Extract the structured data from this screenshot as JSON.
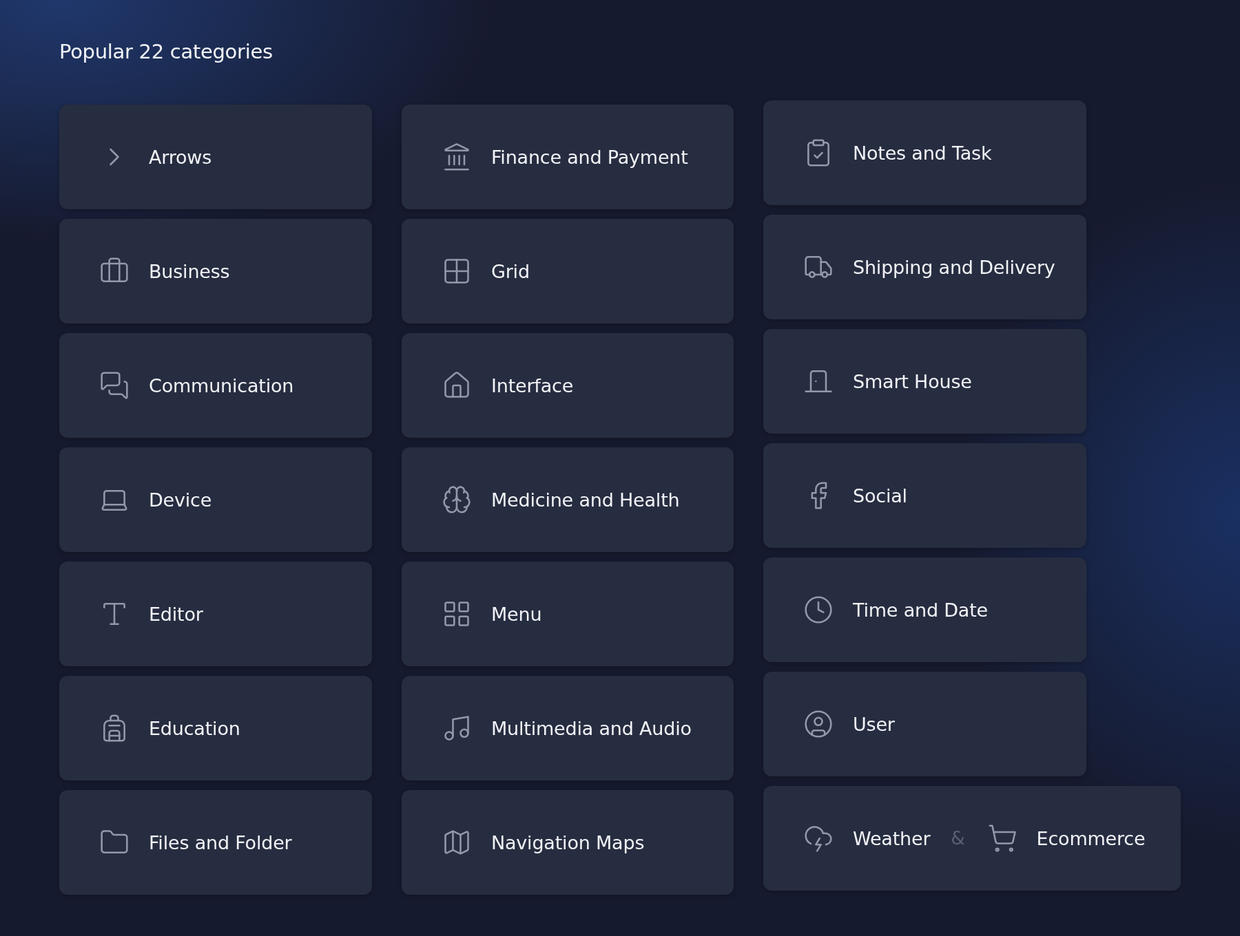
{
  "heading": "Popular 22 categories",
  "columns": [
    {
      "cards": [
        {
          "kind": "single",
          "label": "Arrows"
        },
        {
          "kind": "single",
          "label": "Business"
        },
        {
          "kind": "single",
          "label": "Communication"
        },
        {
          "kind": "single",
          "label": "Device"
        },
        {
          "kind": "single",
          "label": "Editor"
        },
        {
          "kind": "single",
          "label": "Education"
        },
        {
          "kind": "single",
          "label": "Files and Folder"
        }
      ]
    },
    {
      "cards": [
        {
          "kind": "single",
          "label": "Finance and Payment"
        },
        {
          "kind": "single",
          "label": "Grid"
        },
        {
          "kind": "single",
          "label": "Interface"
        },
        {
          "kind": "single",
          "label": "Medicine and Health"
        },
        {
          "kind": "single",
          "label": "Menu"
        },
        {
          "kind": "single",
          "label": "Multimedia and Audio"
        },
        {
          "kind": "single",
          "label": "Navigation Maps"
        }
      ]
    },
    {
      "cards": [
        {
          "kind": "single",
          "label": "Notes and Task"
        },
        {
          "kind": "single",
          "label": "Shipping and Delivery"
        },
        {
          "kind": "single",
          "label": "Smart House"
        },
        {
          "kind": "single",
          "label": "Social"
        },
        {
          "kind": "single",
          "label": "Time and Date"
        },
        {
          "kind": "single",
          "label": "User"
        },
        {
          "kind": "pair",
          "label": "Weather",
          "joiner": "&",
          "second_label": "Ecommerce"
        }
      ]
    }
  ]
}
